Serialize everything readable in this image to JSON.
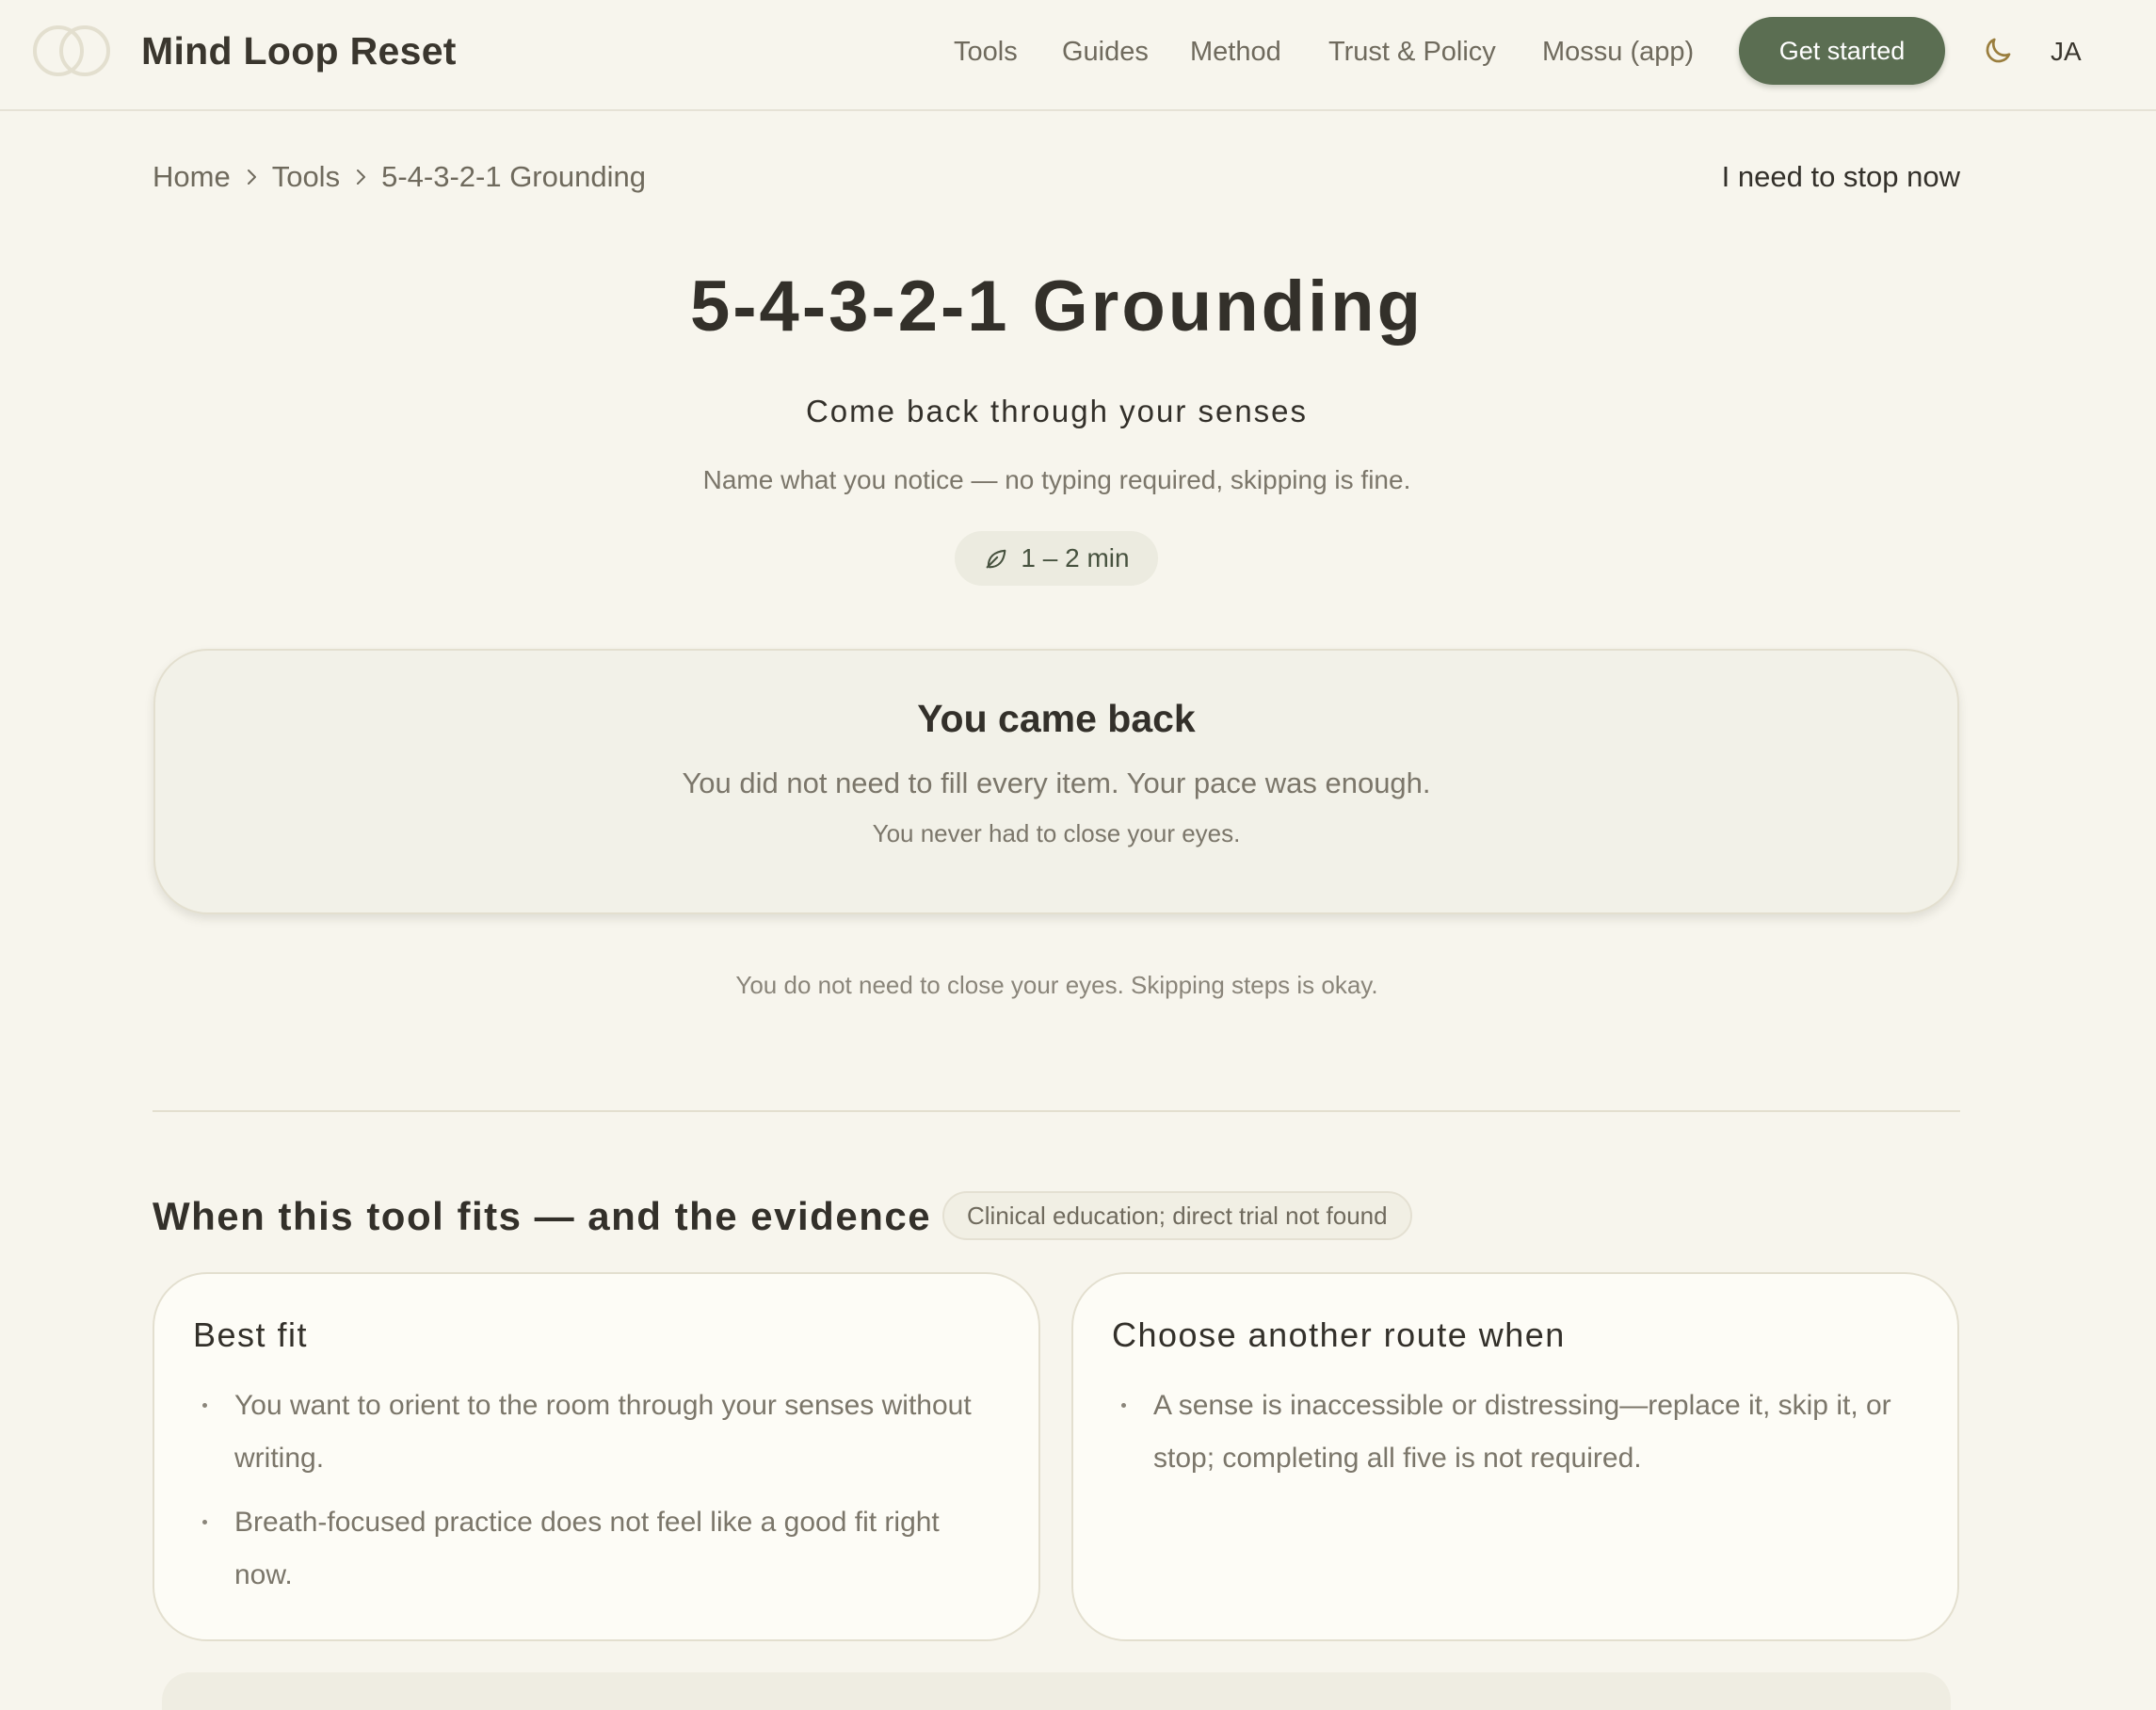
{
  "header": {
    "brand": "Mind Loop Reset",
    "nav": {
      "tools": "Tools",
      "guides": "Guides",
      "method": "Method",
      "trust": "Trust & Policy",
      "mossu": "Mossu (app)"
    },
    "cta_label": "Get started",
    "lang_label": "JA",
    "icons": {
      "logo": "interlocking-rings-logo",
      "theme": "moon-icon"
    }
  },
  "breadcrumb": {
    "home": "Home",
    "tools": "Tools",
    "current": "5-4-3-2-1 Grounding"
  },
  "stop_link": "I need to stop now",
  "hero": {
    "title": "5-4-3-2-1 Grounding",
    "subtitle": "Come back through your senses",
    "note": "Name what you notice — no typing required, skipping is fine.",
    "duration": "1 – 2 min"
  },
  "result": {
    "title": "You came back",
    "line1": "You did not need to fill every item. Your pace was enough.",
    "line2": "You never had to close your eyes."
  },
  "reassurance": "You do not need to close your eyes. Skipping steps is okay.",
  "evidence": {
    "title": "When this tool fits — and the evidence",
    "badge": "Clinical education; direct trial not found",
    "best_fit": {
      "heading": "Best fit",
      "items": [
        "You want to orient to the room through your senses without writing.",
        "Breath-focused practice does not feel like a good fit right now."
      ]
    },
    "other_route": {
      "heading": "Choose another route when",
      "items": [
        "A sense is inaccessible or distressing—replace it, skip it, or stop; completing all five is not required."
      ]
    }
  },
  "colors": {
    "background": "#f7f5ed",
    "accent": "#5b6e52",
    "text": "#33302a",
    "muted_text": "#7b766a",
    "card_border": "#e3dfcf"
  }
}
